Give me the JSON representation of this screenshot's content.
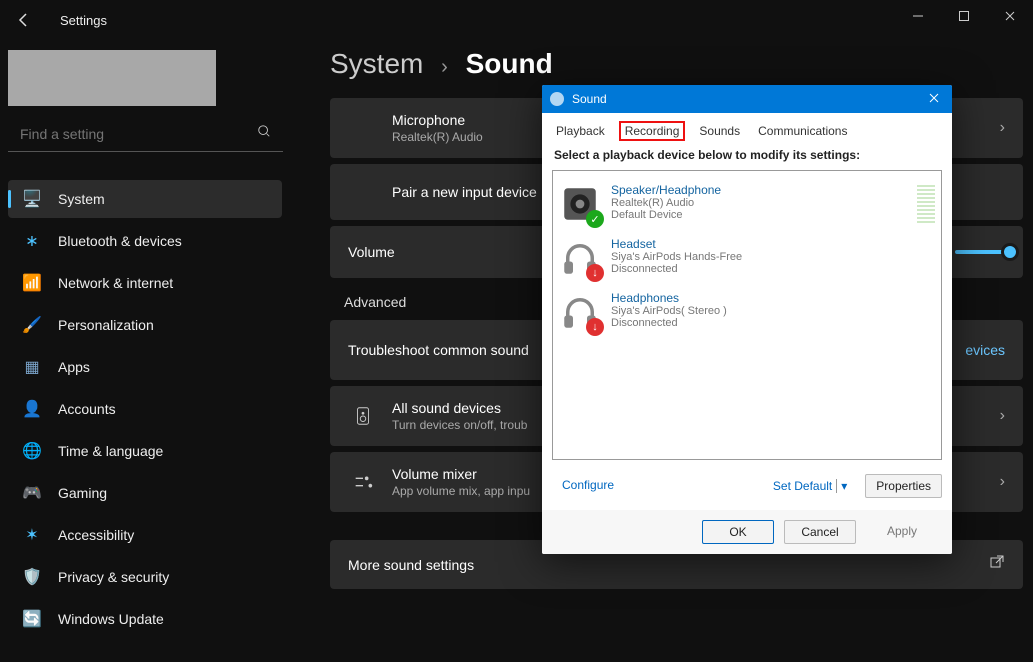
{
  "app": {
    "title": "Settings"
  },
  "search": {
    "placeholder": "Find a setting"
  },
  "nav": {
    "items": [
      {
        "icon": "🖥️",
        "label": "System",
        "color": "#4cc2ff"
      },
      {
        "icon": "∗",
        "label": "Bluetooth & devices",
        "color": "#4cc2ff"
      },
      {
        "icon": "📶",
        "label": "Network & internet",
        "color": "#4cc2ff"
      },
      {
        "icon": "🖌️",
        "label": "Personalization",
        "color": "#d08050"
      },
      {
        "icon": "▦",
        "label": "Apps",
        "color": "#7aa3c9"
      },
      {
        "icon": "👤",
        "label": "Accounts",
        "color": "#3ec97a"
      },
      {
        "icon": "🌐",
        "label": "Time & language",
        "color": "#6fb7e8"
      },
      {
        "icon": "🎮",
        "label": "Gaming",
        "color": "#bcbcbc"
      },
      {
        "icon": "✶",
        "label": "Accessibility",
        "color": "#4cc2ff"
      },
      {
        "icon": "🛡️",
        "label": "Privacy & security",
        "color": "#9aa0a6"
      },
      {
        "icon": "🔄",
        "label": "Windows Update",
        "color": "#4cc2ff"
      }
    ]
  },
  "breadcrumb": {
    "root": "System",
    "leaf": "Sound"
  },
  "sections": {
    "mic": {
      "title": "Microphone",
      "sub": "Realtek(R) Audio"
    },
    "pair": {
      "title": "Pair a new input device"
    },
    "volume": "Volume",
    "advanced": "Advanced",
    "trouble": "Troubleshoot common sound",
    "devices_link": "evices",
    "all": {
      "title": "All sound devices",
      "sub": "Turn devices on/off, troub"
    },
    "mixer": {
      "title": "Volume mixer",
      "sub": "App volume mix, app inpu"
    },
    "more": "More sound settings"
  },
  "dialog": {
    "title": "Sound",
    "tabs": [
      "Playback",
      "Recording",
      "Sounds",
      "Communications"
    ],
    "highlighted_tab": 1,
    "instruction": "Select a playback device below to modify its settings:",
    "devices": [
      {
        "name": "Speaker/Headphone",
        "line2": "Realtek(R) Audio",
        "line3": "Default Device",
        "status": "ok",
        "kind": "speaker"
      },
      {
        "name": "Headset",
        "line2": "Siya's AirPods Hands-Free",
        "line3": "Disconnected",
        "status": "down",
        "kind": "headset"
      },
      {
        "name": "Headphones",
        "line2": "Siya's AirPods( Stereo )",
        "line3": "Disconnected",
        "status": "down",
        "kind": "headset"
      }
    ],
    "buttons": {
      "configure": "Configure",
      "setdefault": "Set Default",
      "properties": "Properties",
      "ok": "OK",
      "cancel": "Cancel",
      "apply": "Apply"
    }
  }
}
